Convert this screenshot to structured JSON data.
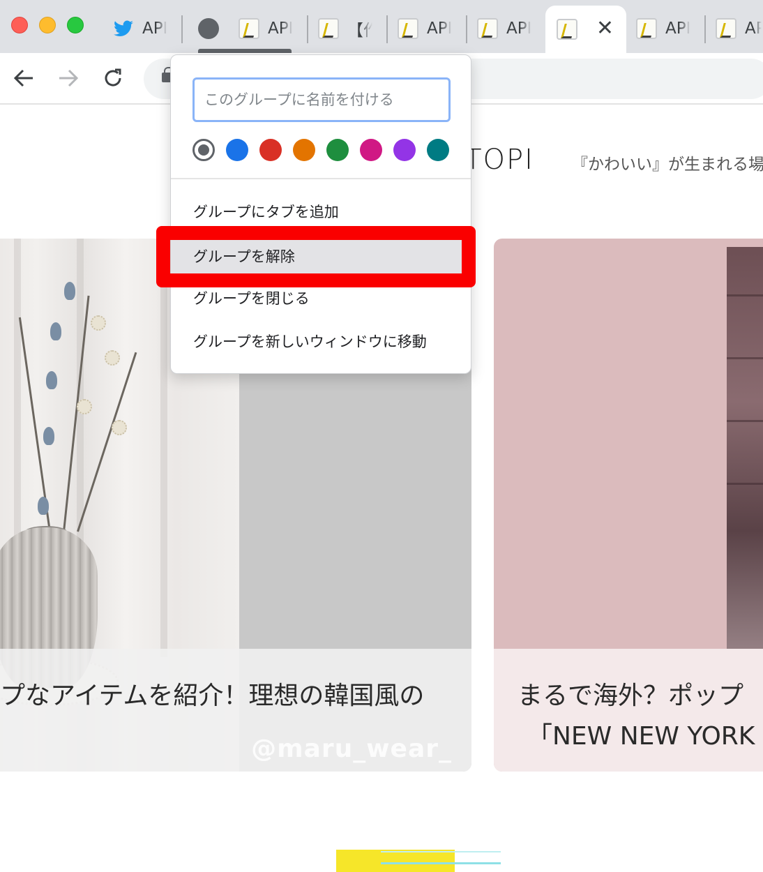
{
  "tabs": [
    {
      "title": "API",
      "favicon": "twitter-bird-icon"
    },
    {
      "title": "",
      "favicon": "tab-group-dot"
    },
    {
      "title": "API",
      "favicon": "note-pencil-icon"
    },
    {
      "title": "【作",
      "favicon": "note-pencil-icon"
    },
    {
      "title": "API",
      "favicon": "note-pencil-icon"
    },
    {
      "title": "API",
      "favicon": "note-pencil-icon"
    },
    {
      "title": "",
      "favicon": "note-pencil-icon",
      "active": true
    },
    {
      "title": "API",
      "favicon": "note-pencil-icon"
    },
    {
      "title": "API",
      "favicon": "note-pencil-icon"
    }
  ],
  "group_menu": {
    "name_placeholder": "このグループに名前を付ける",
    "colors": [
      "#5f6368",
      "#1a73e8",
      "#d93025",
      "#e37400",
      "#1e8e3e",
      "#d01884",
      "#9334e6",
      "#007b83"
    ],
    "items": [
      "グループにタブを追加",
      "グループを解除",
      "グループを閉じる",
      "グループを新しいウィンドウに移動"
    ],
    "highlighted_item": "グループを解除",
    "highlight_color": "#fa0000"
  },
  "page": {
    "logo": "PTOPI",
    "tagline": "『かわいい』が生まれる場",
    "cards": [
      {
        "caption_line1": "プなアイテムを紹介！理想の韓国風の",
        "watermark": "@maru_wear_"
      },
      {
        "caption_line1": "まるで海外？ポップ",
        "caption_line2": "「NEW NEW YORK C"
      }
    ]
  }
}
